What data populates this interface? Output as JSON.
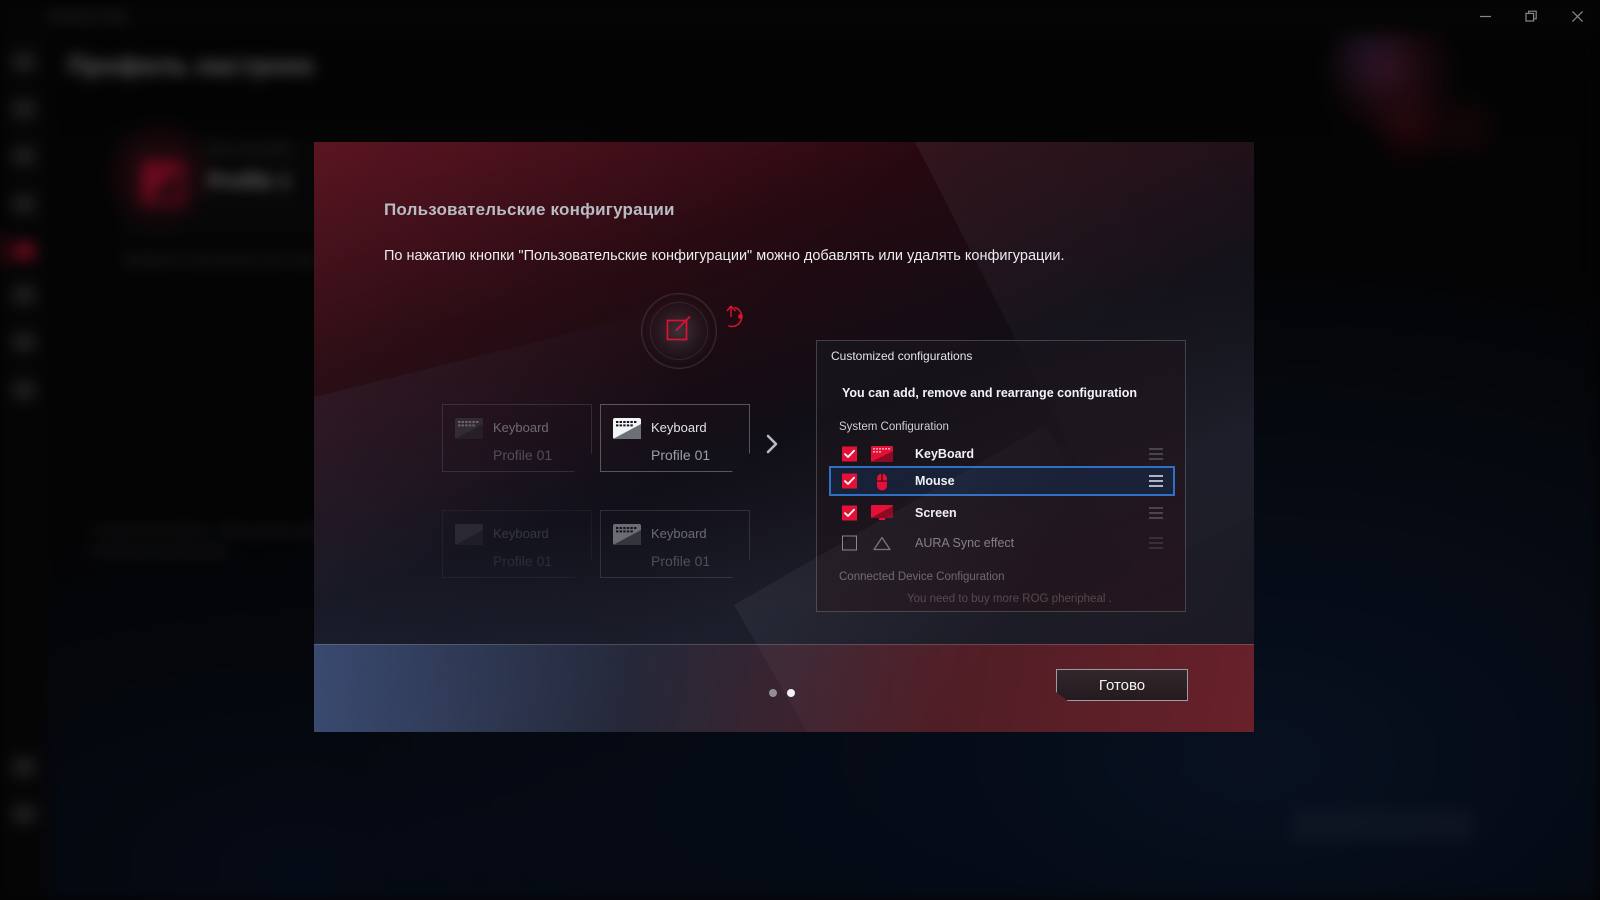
{
  "window": {
    "app_title": "Armoury Crate",
    "controls": [
      {
        "name": "minimize",
        "glyph": "minimize-icon"
      },
      {
        "name": "restore",
        "glyph": "restore-icon"
      },
      {
        "name": "close",
        "glyph": "close-icon"
      }
    ]
  },
  "background": {
    "page_heading": "Профиль настроек",
    "profile_card": {
      "subtitle": "Имя настройки",
      "title": "Profile 1",
      "logo": "rog-logo"
    },
    "note": "Выберите приложение для игры",
    "paragraph": "Созданный профиль. Также можно привязать к активному приложению.",
    "sidebar_items": [
      {
        "name": "home",
        "active": false
      },
      {
        "name": "device",
        "active": false
      },
      {
        "name": "lighting",
        "active": false
      },
      {
        "name": "scenario",
        "active": false
      },
      {
        "name": "profiles",
        "active": true
      },
      {
        "name": "tools",
        "active": false
      },
      {
        "name": "game-library",
        "active": false
      },
      {
        "name": "news",
        "active": false
      },
      {
        "name": "notifications",
        "active": false
      },
      {
        "name": "settings",
        "active": false
      }
    ]
  },
  "overlay": {
    "title": "Пользовательские конфигурации",
    "description": "По нажатию кнопки \"Пользовательские конфигурации\" можно добавлять или удалять конфигурации.",
    "cards": [
      {
        "device": "Keyboard",
        "profile": "Profile 01",
        "state": "dim"
      },
      {
        "device": "Keyboard",
        "profile": "Profile 01",
        "state": "normal"
      },
      {
        "device": "Keyboard",
        "profile": "Profile 01",
        "state": "faded"
      },
      {
        "device": "Keyboard",
        "profile": "Profile 01",
        "state": "dim"
      }
    ],
    "config_panel": {
      "header": "Customized configurations",
      "subtitle": "You can add, remove and rearrange configuration",
      "group_system": "System Configuration",
      "group_connected": "Connected Device Configuration",
      "footer_note": "You need to buy more ROG pheripheal .",
      "rows": [
        {
          "label": "KeyBoard",
          "checked": true,
          "icon": "keyboard-icon",
          "selected": false
        },
        {
          "label": "Mouse",
          "checked": true,
          "icon": "mouse-icon",
          "selected": true
        },
        {
          "label": "Screen",
          "checked": true,
          "icon": "screen-icon",
          "selected": false
        },
        {
          "label": "AURA Sync effect",
          "checked": false,
          "icon": "aura-icon",
          "selected": false
        }
      ]
    },
    "footer": {
      "done_label": "Готово",
      "dots_total": 2,
      "dot_active_index": 1
    }
  },
  "colors": {
    "accent_red": "#e31138",
    "selection_blue": "#2f6fc4",
    "text_primary": "#f0f1f4",
    "text_muted": "#9b9ea6"
  }
}
